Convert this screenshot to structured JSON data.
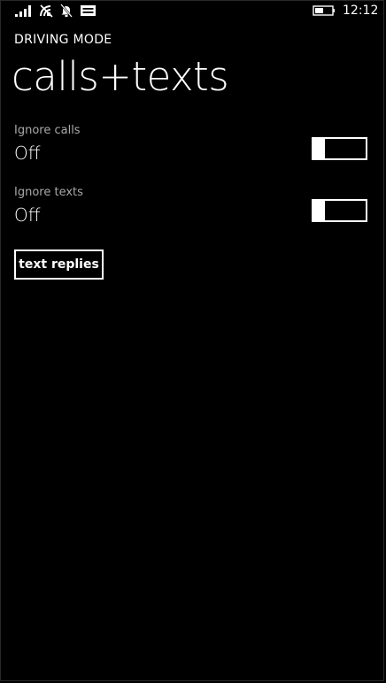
{
  "status_bar": {
    "clock": "12:12",
    "icons": [
      "signal-strength-icon",
      "wifi-icon",
      "muted-bell-icon",
      "message-icon",
      "battery-icon"
    ]
  },
  "header": {
    "app_title": "DRIVING MODE",
    "page_title": "calls+texts"
  },
  "settings": [
    {
      "label": "Ignore calls",
      "value": "Off",
      "enabled": false
    },
    {
      "label": "Ignore texts",
      "value": "Off",
      "enabled": false
    }
  ],
  "actions": {
    "text_replies_label": "text replies"
  },
  "colors": {
    "background": "#000000",
    "foreground": "#ffffff",
    "secondary_text": "#a9a9a9"
  }
}
